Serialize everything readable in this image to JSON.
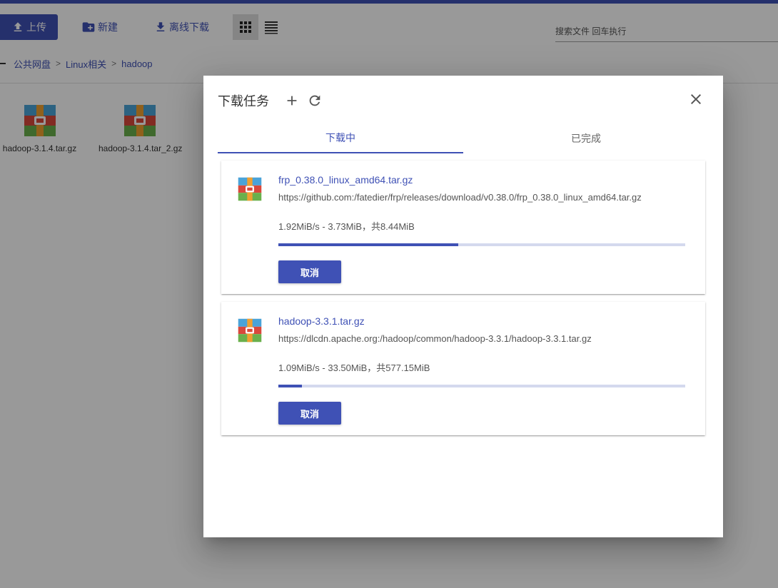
{
  "colors": {
    "primary": "#3f51b5",
    "track": "#d4d9ee",
    "overlay": "rgba(0,0,0,0.4)"
  },
  "toolbar": {
    "upload": {
      "label": "上传",
      "icon": "upload-icon"
    },
    "new": {
      "label": "新建",
      "icon": "new-folder-icon"
    },
    "offline": {
      "label": "离线下载",
      "icon": "download-icon"
    },
    "grid_view_icon": "grid-view-icon",
    "list_view_icon": "list-view-icon",
    "search_placeholder": "搜索文件 回车执行"
  },
  "breadcrumb": [
    "公共网盘",
    "Linux相关",
    "hadoop"
  ],
  "files": [
    {
      "name": "hadoop-3.1.4.tar.gz",
      "icon": "archive-icon"
    },
    {
      "name": "hadoop-3.1.4.tar_2.gz",
      "icon": "archive-icon"
    }
  ],
  "dialog": {
    "title": "下载任务",
    "tabs": [
      {
        "label": "下载中",
        "active": true
      },
      {
        "label": "已完成",
        "active": false
      }
    ],
    "tasks": [
      {
        "name": "frp_0.38.0_linux_amd64.tar.gz",
        "url": "https://github.com:/fatedier/frp/releases/download/v0.38.0/frp_0.38.0_linux_amd64.tar.gz",
        "stats": "1.92MiB/s - 3.73MiB，共8.44MiB",
        "progress": 0.442,
        "cancel_label": "取消"
      },
      {
        "name": "hadoop-3.3.1.tar.gz",
        "url": "https://dlcdn.apache.org:/hadoop/common/hadoop-3.3.1/hadoop-3.3.1.tar.gz",
        "stats": "1.09MiB/s - 33.50MiB，共577.15MiB",
        "progress": 0.058,
        "cancel_label": "取消"
      }
    ]
  }
}
